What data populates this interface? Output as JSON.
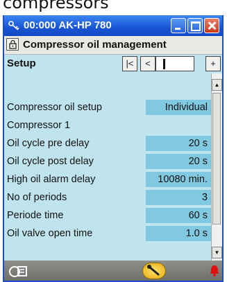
{
  "caption": "compressors",
  "window": {
    "title": "00:000 AK-HP 780"
  },
  "header": {
    "title": "Compressor oil management"
  },
  "setup": {
    "label": "Setup",
    "nav_first": "|<",
    "nav_prev": "<",
    "nav_next": "+"
  },
  "rows": [
    {
      "label": "Compressor oil setup",
      "value": "Individual"
    },
    {
      "label": "Compressor 1"
    },
    {
      "label": "Oil cycle pre delay",
      "value": "20 s"
    },
    {
      "label": "Oil cycle post delay",
      "value": "20 s"
    },
    {
      "label": "High oil alarm delay",
      "value": "10080 min."
    },
    {
      "label": "No of periods",
      "value": "3"
    },
    {
      "label": "Periode time",
      "value": "60 s"
    },
    {
      "label": "Oil valve open time",
      "value": "1.0 s"
    }
  ],
  "colors": {
    "titlebar": "#1a55d6",
    "background": "#bfe4ee",
    "value_field": "#80c9e1",
    "alarm": "#e01010"
  },
  "icons": {
    "app": "key-icon",
    "lock": "lock-icon",
    "footer_left": "tools-icon",
    "footer_mid": "wrench-icon",
    "footer_right": "alarm-bell-icon"
  }
}
